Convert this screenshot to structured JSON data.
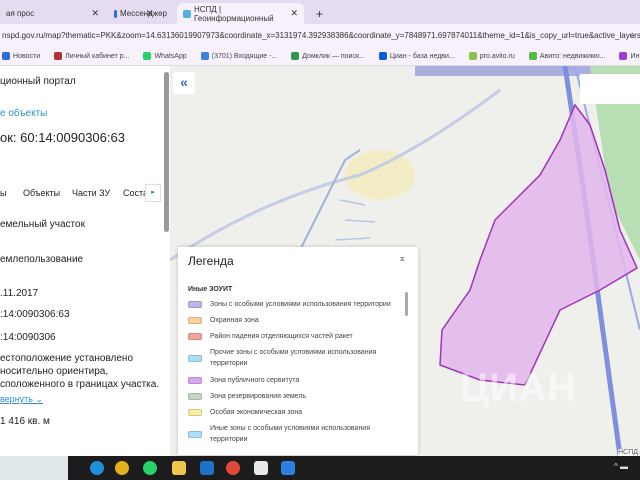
{
  "tabs": [
    {
      "label": "ая прос"
    },
    {
      "label": "Мессенджер"
    },
    {
      "label": "НСПД | Геоинформационный"
    }
  ],
  "new_tab": "+",
  "url": "nspd.gov.ru/map?thematic=PKK&zoom=14.63136019907973&coordinate_x=3131974.392938386&coordinate_y=7848971.697874011&theme_id=1&is_copy_url=true&active_layers...",
  "bookmarks": [
    {
      "label": "Новости",
      "color": "#2d6fd8"
    },
    {
      "label": "Личный кабинет р...",
      "color": "#a33"
    },
    {
      "label": "WhatsApp",
      "color": "#25d366"
    },
    {
      "label": "(3701) Входящие -...",
      "color": "#3a7ee0"
    },
    {
      "label": "Домклик — поиск...",
      "color": "#2a9a4a"
    },
    {
      "label": "Циан - база недви...",
      "color": "#0a5cd8"
    },
    {
      "label": "pro.avito.ru",
      "color": "#8bc34a"
    },
    {
      "label": "Авито: недвижимо...",
      "color": "#57b947"
    },
    {
      "label": "Интернет-м",
      "color": "#a03cd0"
    }
  ],
  "side": {
    "portal": "ционный портал",
    "link": "е объекты",
    "title": "ок: 60:14:0090306:63",
    "subtabs": [
      "ы",
      "Объекты",
      "Части ЗУ",
      "Соста"
    ],
    "values": [
      "емельный участок",
      "емлепользование",
      ".11.2017",
      ":14:0090306:63",
      ":14:0090306"
    ],
    "address": [
      "естоположение установлено",
      "носительно ориентира,",
      "сположенного в границах участка."
    ],
    "collapse": "вернуть",
    "area": "1 416 кв. м"
  },
  "legend": {
    "title": "Легенда",
    "group": "Иные ЗОУИТ",
    "items": [
      {
        "label": "Зоны с особыми условиями использования территории",
        "color": "#b9b8e6"
      },
      {
        "label": "Охранная зона",
        "color": "#fcd29a"
      },
      {
        "label": "Район падения отделяющихся частей ракет",
        "color": "#f2a3a0"
      },
      {
        "label": "Прочие зоны с особыми условиями использования территории",
        "color": "#a9dff7"
      },
      {
        "label": "Зона публичного сервитута",
        "color": "#d8a6f0"
      },
      {
        "label": "Зона резервирования земель",
        "color": "#c8d4c6"
      },
      {
        "label": "Особая экономическая зона",
        "color": "#f7eda0"
      },
      {
        "label": "Иные зоны с особыми условиями использования территории",
        "color": "#a9dff7"
      }
    ]
  },
  "map": {
    "watermark": "ЦИАН",
    "corner": "НСПД",
    "parcel_color": "#e3b6ec",
    "parcel_border": "#a133b8"
  }
}
